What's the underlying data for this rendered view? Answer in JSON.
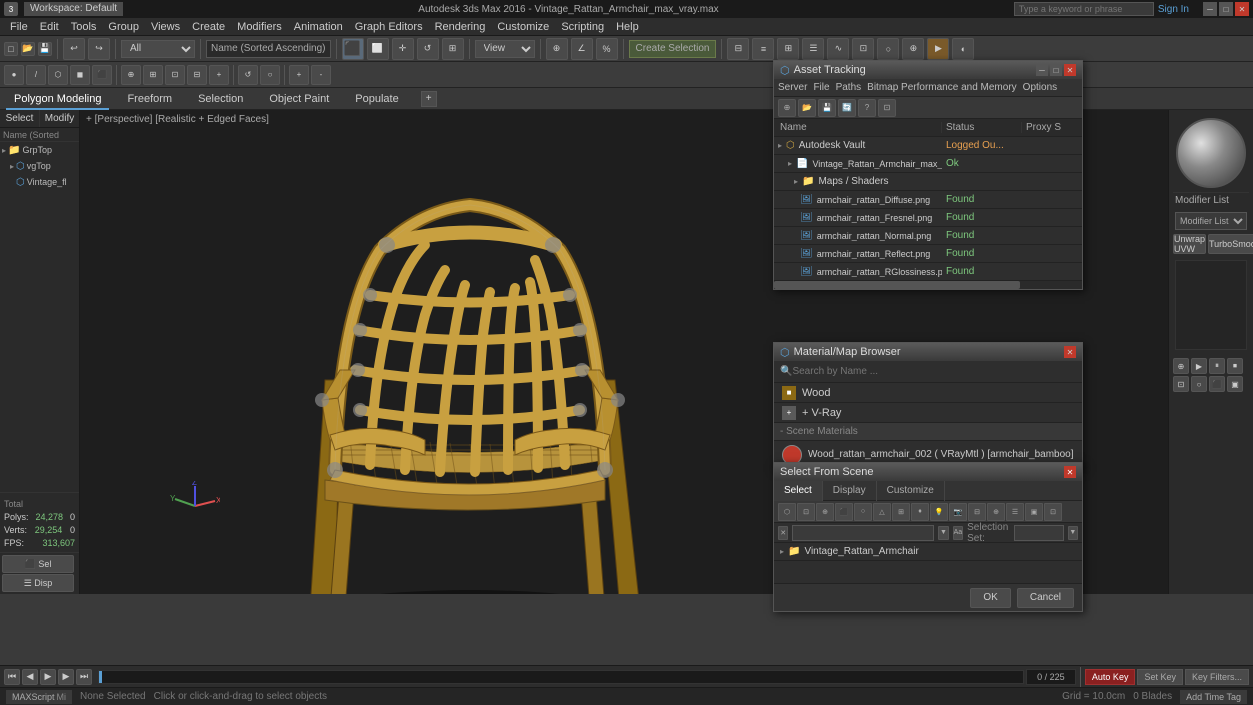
{
  "app": {
    "title": "Autodesk 3ds Max 2016 - Vintage_Rattan_Armchair_max_vray.max",
    "workspace": "Workspace: Default",
    "sign_in": "Sign In"
  },
  "titlebar": {
    "min": "─",
    "max": "□",
    "close": "✕"
  },
  "menu": {
    "items": [
      "File",
      "Edit",
      "Tools",
      "Group",
      "Views",
      "Create",
      "Modifiers",
      "Animation",
      "Graph Editors",
      "Rendering",
      "Customize",
      "Scripting",
      "Help"
    ]
  },
  "toolbar1": {
    "undo": "↩",
    "redo": "↪",
    "select_label": "Name (Sorted Ascending)",
    "select_filter": "All",
    "view_dropdown": "View"
  },
  "toolbar2": {
    "buttons": [
      "⊕",
      "↔",
      "↕",
      "⊡",
      "△",
      "○",
      "⬡",
      "☰",
      "⊞",
      "⬛",
      "▶",
      "⊕"
    ]
  },
  "mode_tabs": {
    "items": [
      "Polygon Modeling",
      "Freeform",
      "Selection",
      "Object Paint",
      "Populate",
      ""
    ]
  },
  "left_panel": {
    "labels": [
      "Select",
      "Modify"
    ],
    "select_label": "Select",
    "modify_label": "Modify"
  },
  "scene_tree": {
    "header_select": "Select",
    "header_display": "Display",
    "label": "Name (Sorted Asc",
    "nodes": [
      {
        "name": "GrpTop",
        "indent": 0,
        "icon": "folder"
      },
      {
        "name": "vgTop",
        "indent": 1,
        "icon": "mesh"
      },
      {
        "name": "Vintage_fl",
        "indent": 2,
        "icon": "mesh"
      }
    ],
    "polys": {
      "label": "Polys:",
      "value": "24,278",
      "extra": "0"
    },
    "verts": {
      "label": "Verts:",
      "value": "29,254",
      "extra": "0"
    },
    "fps_label": "FPS:",
    "fps_value": "313,607"
  },
  "viewport": {
    "label": "+ [Perspective] [Realistic + Edged Faces]",
    "grid_visible": true
  },
  "right_panel": {
    "modifier_list_label": "Modifier List",
    "unwrap_uvw_btn": "Unwrap UVW",
    "turbo_smooth_btn": "TurboSmooth"
  },
  "asset_tracking": {
    "title": "Asset Tracking",
    "menu": [
      "Server",
      "File",
      "Paths",
      "Bitmap Performance and Memory",
      "Options"
    ],
    "columns": [
      "Name",
      "Status",
      "Proxy S"
    ],
    "rows": [
      {
        "name": "Autodesk Vault",
        "indent": 0,
        "status": "Logged Ou...",
        "status_class": "status-loggedout",
        "icon": "vault"
      },
      {
        "name": "Vintage_Rattan_Armchair_max_vray.max",
        "indent": 1,
        "status": "Ok",
        "status_class": "status-ok",
        "icon": "file"
      },
      {
        "name": "Maps / Shaders",
        "indent": 2,
        "status": "",
        "icon": "folder"
      },
      {
        "name": "armchair_rattan_Diffuse.png",
        "indent": 3,
        "status": "Found",
        "status_class": "status-found",
        "icon": "image"
      },
      {
        "name": "armchair_rattan_Fresnel.png",
        "indent": 3,
        "status": "Found",
        "status_class": "status-found",
        "icon": "image"
      },
      {
        "name": "armchair_rattan_Normal.png",
        "indent": 3,
        "status": "Found",
        "status_class": "status-found",
        "icon": "image"
      },
      {
        "name": "armchair_rattan_Reflect.png",
        "indent": 3,
        "status": "Found",
        "status_class": "status-found",
        "icon": "image"
      },
      {
        "name": "armchair_rattan_RGlossiness.png",
        "indent": 3,
        "status": "Found",
        "status_class": "status-found",
        "icon": "image"
      }
    ]
  },
  "material_browser": {
    "title": "Material/Map Browser",
    "search_placeholder": "Search by Name ...",
    "categories": [
      {
        "name": "Wood",
        "type": "material",
        "icon": "■"
      },
      {
        "name": "+ V-Ray",
        "type": "vray",
        "icon": "+"
      }
    ],
    "section_label": "- Scene Materials",
    "materials": [
      {
        "name": "Wood_rattan_armchair_002 ( VRayMtl ) [armchair_bamboo]",
        "swatch_color": "#c0392b"
      }
    ]
  },
  "select_from_scene": {
    "title": "Select From Scene",
    "tabs": [
      "Select",
      "Display",
      "Customize"
    ],
    "active_tab": "Select",
    "search_placeholder": "",
    "selection_set_label": "Selection Set:",
    "selection_set_value": "",
    "tree_nodes": [
      {
        "name": "Vintage_Rattan_Armchair",
        "indent": 0,
        "icon": "mesh",
        "expanded": true
      }
    ],
    "ok_label": "OK",
    "cancel_label": "Cancel"
  },
  "bottom_bar": {
    "slider_value": "0 / 225",
    "time_controls": [
      "◀◀",
      "◀",
      "●",
      "▶",
      "▶▶"
    ],
    "key_mode": "Auto Key",
    "set_key": "Set Key",
    "key_filters": "Key Filters..."
  },
  "status_bar": {
    "selection": "None Selected",
    "hint": "Click or click-and-drag to select objects",
    "grid": "Grid = 10.0cm",
    "blade_info": "0 Blades",
    "time": "0/225",
    "add_time_tag": "Add Time Tag"
  }
}
